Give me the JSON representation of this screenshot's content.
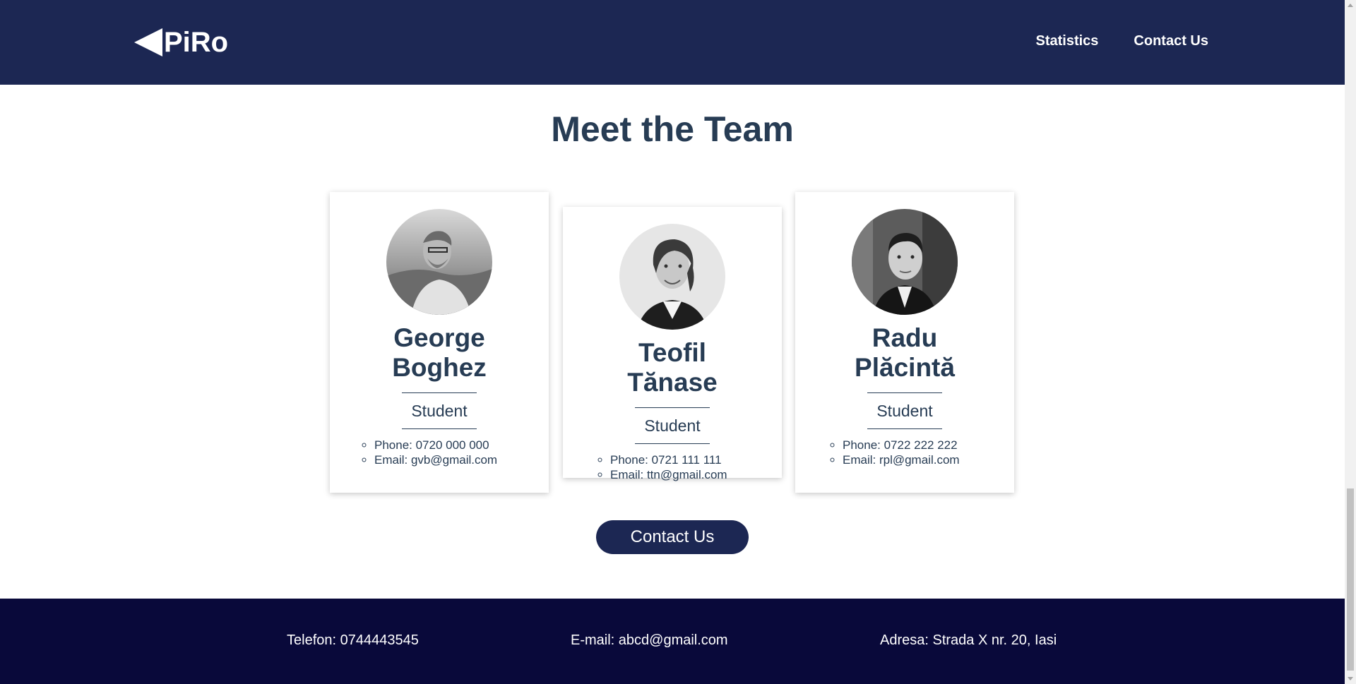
{
  "header": {
    "logo_text": "PiRo",
    "nav": [
      {
        "label": "Statistics"
      },
      {
        "label": "Contact Us"
      }
    ]
  },
  "main": {
    "title": "Meet the Team",
    "team": [
      {
        "name": "George Boghez",
        "role": "Student",
        "phone": "Phone: 0720 000 000",
        "email": "Email: gvb@gmail.com"
      },
      {
        "name": "Teofil Tănase",
        "role": "Student",
        "phone": "Phone: 0721 111 111",
        "email": "Email: ttn@gmail.com"
      },
      {
        "name": "Radu Plăcintă",
        "role": "Student",
        "phone": "Phone: 0722 222 222",
        "email": "Email: rpl@gmail.com"
      }
    ],
    "contact_button": "Contact Us"
  },
  "footer": {
    "phone": "Telefon: 0744443545",
    "email": "E-mail: abcd@gmail.com",
    "address": "Adresa: Strada X nr. 20, Iasi"
  },
  "colors": {
    "header_bg": "#1c2753",
    "footer_bg": "#09093a",
    "text": "#273c54"
  }
}
